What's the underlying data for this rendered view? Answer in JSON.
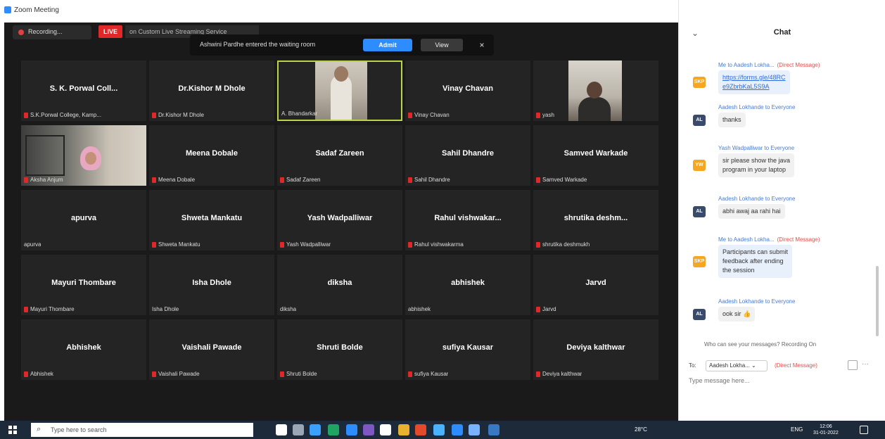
{
  "window": {
    "title": "Zoom Meeting",
    "controls": [
      "—",
      "❐",
      "✕"
    ]
  },
  "top_bar": {
    "recording_label": "Recording...",
    "live_badge": "LIVE",
    "live_text": "on Custom Live Streaming Service"
  },
  "waiting_room": {
    "text": "Ashwini Pardhe entered the waiting room",
    "admit_label": "Admit",
    "view_label": "View",
    "close_glyph": "×"
  },
  "participants": [
    {
      "name": "S. K. Porwal Coll...",
      "label": "S.K.Porwal College, Kamp...",
      "muted": true,
      "video": ""
    },
    {
      "name": "Dr.Kishor M Dhole",
      "label": "Dr.Kishor M Dhole",
      "muted": true,
      "video": ""
    },
    {
      "name": "",
      "label": "A. Bhandarkar",
      "muted": false,
      "video": "a",
      "active": true
    },
    {
      "name": "Vinay Chavan",
      "label": "Vinay Chavan",
      "muted": true,
      "video": ""
    },
    {
      "name": "",
      "label": "yash",
      "muted": true,
      "video": "b"
    },
    {
      "name": "",
      "label": "Aksha Anjum",
      "muted": true,
      "video": "c"
    },
    {
      "name": "Meena Dobale",
      "label": "Meena Dobale",
      "muted": true,
      "video": ""
    },
    {
      "name": "Sadaf Zareen",
      "label": "Sadaf Zareen",
      "muted": true,
      "video": ""
    },
    {
      "name": "Sahil Dhandre",
      "label": "Sahil Dhandre",
      "muted": true,
      "video": ""
    },
    {
      "name": "Samved Warkade",
      "label": "Samved Warkade",
      "muted": true,
      "video": ""
    },
    {
      "name": "apurva",
      "label": "apurva",
      "muted": false,
      "video": ""
    },
    {
      "name": "Shweta Mankatu",
      "label": "Shweta Mankatu",
      "muted": true,
      "video": ""
    },
    {
      "name": "Yash Wadpalliwar",
      "label": "Yash Wadpalliwar",
      "muted": true,
      "video": ""
    },
    {
      "name": "Rahul vishwakar...",
      "label": "Rahul vishwakarma",
      "muted": true,
      "video": ""
    },
    {
      "name": "shrutika deshm...",
      "label": "shrutika deshmukh",
      "muted": true,
      "video": ""
    },
    {
      "name": "Mayuri Thombare",
      "label": "Mayuri Thombare",
      "muted": true,
      "video": ""
    },
    {
      "name": "Isha Dhole",
      "label": "Isha Dhole",
      "muted": false,
      "video": ""
    },
    {
      "name": "diksha",
      "label": "diksha",
      "muted": false,
      "video": ""
    },
    {
      "name": "abhishek",
      "label": "abhishek",
      "muted": false,
      "video": ""
    },
    {
      "name": "Jarvd",
      "label": "Jarvd",
      "muted": true,
      "video": ""
    },
    {
      "name": "Abhishek",
      "label": "Abhishek",
      "muted": true,
      "video": ""
    },
    {
      "name": "Vaishali Pawade",
      "label": "Vaishali Pawade",
      "muted": true,
      "video": ""
    },
    {
      "name": "Shruti Bolde",
      "label": "Shruti Bolde",
      "muted": true,
      "video": ""
    },
    {
      "name": "sufiya Kausar",
      "label": "sufiya Kausar",
      "muted": true,
      "video": ""
    },
    {
      "name": "Deviya kalthwar",
      "label": "Deviya kalthwar",
      "muted": true,
      "video": ""
    }
  ],
  "chat": {
    "title": "Chat",
    "collapse_glyph": "⌄",
    "messages": [
      {
        "avatar": "SKP",
        "avatar_color": "#f5a623",
        "sender": "Me to Aadesh Lokha...",
        "dm": "(Direct Message)",
        "lines": [
          "https://forms.gle/48RC",
          "e9ZbrbKaL5S9A"
        ],
        "is_link": true,
        "gray": false
      },
      {
        "avatar": "AL",
        "avatar_color": "#3a4a6b",
        "sender": "Aadesh Lokhande to Everyone",
        "dm": "",
        "lines": [
          "thanks"
        ],
        "is_link": false,
        "gray": true
      },
      {
        "avatar": "YW",
        "avatar_color": "#f5a623",
        "sender": "Yash Wadpalliwar to Everyone",
        "dm": "",
        "lines": [
          "sir please show the java",
          "program in your laptop"
        ],
        "is_link": false,
        "gray": true
      },
      {
        "avatar": "AL",
        "avatar_color": "#3a4a6b",
        "sender": "Aadesh Lokhande to Everyone",
        "dm": "",
        "lines": [
          "abhi awaj aa rahi hai"
        ],
        "is_link": false,
        "gray": true
      },
      {
        "avatar": "SKP",
        "avatar_color": "#f5a623",
        "sender": "Me to Aadesh Lokha...",
        "dm": "(Direct Message)",
        "lines": [
          "Participants can submit",
          "feedback after ending",
          "the session"
        ],
        "is_link": false,
        "gray": false
      },
      {
        "avatar": "AL",
        "avatar_color": "#3a4a6b",
        "sender": "Aadesh Lokhande to Everyone",
        "dm": "",
        "lines": [
          "ook sir 👍"
        ],
        "is_link": false,
        "gray": true
      }
    ],
    "who_can_see": "Who can see your messages? Recording On",
    "to_label": "To:",
    "to_value": "Aadesh Lokha... ⌄",
    "to_dm": "(Direct Message)",
    "more_glyph": "···",
    "input_placeholder": "Type message here..."
  },
  "taskbar": {
    "search_placeholder": "Type here to search",
    "weather": "28°C",
    "lang": "ENG",
    "time": "12:06",
    "date": "31-01-2022",
    "app_colors": [
      "#ffffff",
      "#9aa6b6",
      "#3aa0ff",
      "#1fa463",
      "#2d8cff",
      "#7e57c2",
      "#ffffff",
      "#e8b230",
      "#e24a2b",
      "#4ab3ff",
      "#2d8cff",
      "#7ab2ff",
      "#3b78c4"
    ]
  }
}
